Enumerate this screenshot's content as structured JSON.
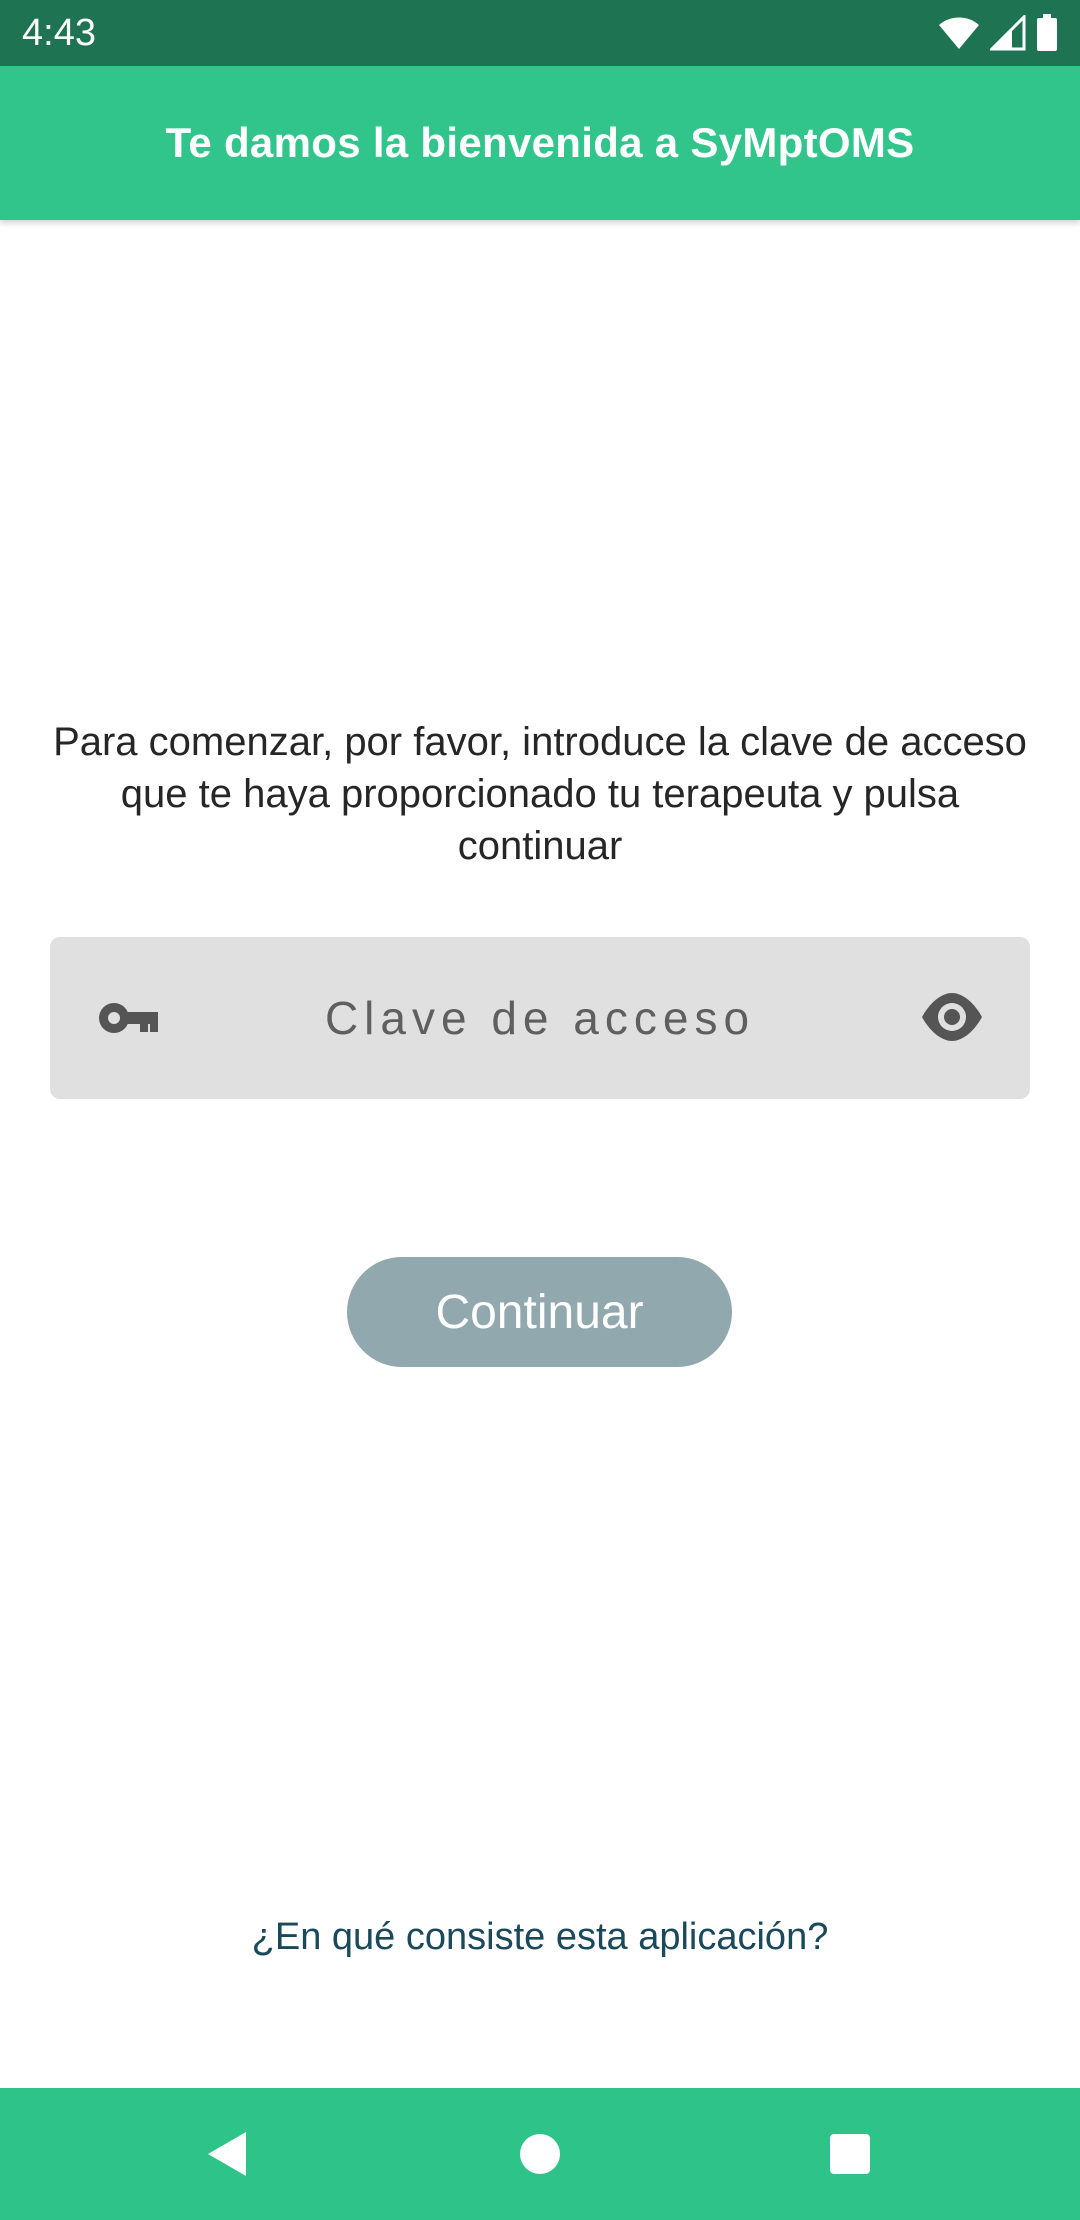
{
  "status_bar": {
    "time": "4:43",
    "icons": [
      "wifi-icon",
      "signal-icon",
      "battery-icon"
    ]
  },
  "app_bar": {
    "title": "Te damos la bienvenida a SyMptOMS"
  },
  "main": {
    "instruction": "Para comenzar, por favor, introduce la clave de acceso que te haya proporcionado tu terapeuta y pulsa continuar",
    "password_field": {
      "placeholder": "Clave de acceso",
      "value": "",
      "leading_icon": "key-icon",
      "trailing_icon": "eye-icon"
    },
    "continue_label": "Continuar",
    "info_link": "¿En qué consiste esta aplicación?"
  },
  "nav_bar": {
    "buttons": [
      "back-icon",
      "home-icon",
      "recents-icon"
    ]
  },
  "colors": {
    "status_bar": "#1e7452",
    "app_bar": "#31c58b",
    "nav_bar": "#2ec489",
    "field_bg": "#e0e0e0",
    "button_disabled": "#90a8ae",
    "link": "#19495a"
  }
}
